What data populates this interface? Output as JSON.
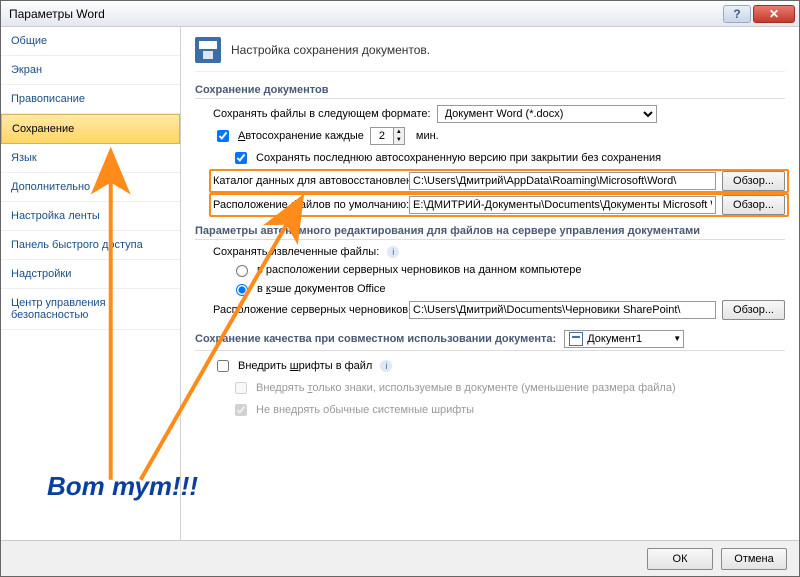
{
  "titlebar": {
    "title": "Параметры Word"
  },
  "sidebar": {
    "items": [
      {
        "label": "Общие"
      },
      {
        "label": "Экран"
      },
      {
        "label": "Правописание"
      },
      {
        "label": "Сохранение",
        "selected": true
      },
      {
        "label": "Язык"
      },
      {
        "label": "Дополнительно"
      },
      {
        "label": "Настройка ленты"
      },
      {
        "label": "Панель быстрого доступа"
      },
      {
        "label": "Надстройки"
      },
      {
        "label": "Центр управления безопасностью"
      }
    ]
  },
  "page": {
    "heading": "Настройка сохранения документов."
  },
  "saveDocs": {
    "title": "Сохранение документов",
    "formatLabel": "Сохранять файлы в следующем формате:",
    "formatValue": "Документ Word (*.docx)",
    "autosaveLabel": "Автосохранение каждые",
    "autosaveValue": "2",
    "autosaveUnit": "мин.",
    "keepLastLabel": "Сохранять последнюю автосохраненную версию при закрытии без сохранения",
    "recoveryLabel": "Каталог данных для автовосстановления:",
    "recoveryPath": "C:\\Users\\Дмитрий\\AppData\\Roaming\\Microsoft\\Word\\",
    "defaultLocLabel": "Расположение файлов по умолчанию:",
    "defaultLocPath": "E:\\ДМИТРИЙ-Документы\\Documents\\Документы Microsoft Word",
    "browse": "Обзор..."
  },
  "serverEdit": {
    "title": "Параметры автономного редактирования для файлов на сервере управления документами",
    "keepExtractedLabel": "Сохранять извлеченные файлы:",
    "opt1": "в расположении серверных черновиков на данном компьютере",
    "opt2": "в кэше документов Office",
    "draftsLabel": "Расположение серверных черновиков:",
    "draftsPath": "C:\\Users\\Дмитрий\\Documents\\Черновики SharePoint\\",
    "browse": "Обзор..."
  },
  "quality": {
    "title": "Сохранение качества при совместном использовании документа:",
    "docName": "Документ1",
    "embedFonts": "Внедрить шрифты в файл",
    "onlyUsed": "Внедрять только знаки, используемые в документе (уменьшение размера файла)",
    "noSystem": "Не внедрять обычные системные шрифты"
  },
  "footer": {
    "ok": "ОК",
    "cancel": "Отмена"
  },
  "annotation": {
    "text": "Вот тут!!!"
  }
}
